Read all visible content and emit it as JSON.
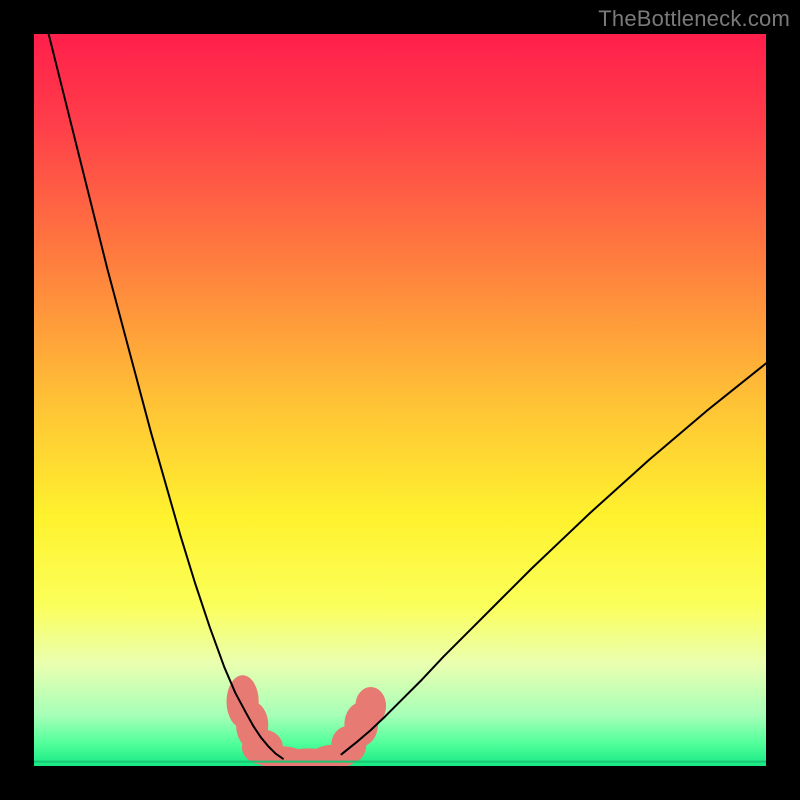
{
  "watermark": "TheBottleneck.com",
  "chart_data": {
    "type": "line",
    "title": "",
    "xlabel": "",
    "ylabel": "",
    "xlim": [
      0,
      100
    ],
    "ylim": [
      0,
      100
    ],
    "background_gradient": {
      "stops": [
        {
          "offset": 0.0,
          "color": "#ff1f4b"
        },
        {
          "offset": 0.12,
          "color": "#ff3d4a"
        },
        {
          "offset": 0.3,
          "color": "#ff7a3f"
        },
        {
          "offset": 0.5,
          "color": "#ffc136"
        },
        {
          "offset": 0.66,
          "color": "#fff22e"
        },
        {
          "offset": 0.78,
          "color": "#fbff5a"
        },
        {
          "offset": 0.86,
          "color": "#eaffb0"
        },
        {
          "offset": 0.93,
          "color": "#a7ffb8"
        },
        {
          "offset": 0.97,
          "color": "#4fff9a"
        },
        {
          "offset": 1.0,
          "color": "#17e884"
        }
      ]
    },
    "series": [
      {
        "name": "left-curve",
        "color": "#000000",
        "width": 2.0,
        "x": [
          0,
          2,
          4,
          6,
          8,
          10,
          12,
          14,
          16,
          18,
          20,
          22,
          24,
          26,
          27.5,
          29,
          30,
          31,
          32,
          33,
          34
        ],
        "y": [
          108,
          100,
          92,
          84,
          76,
          68,
          60.5,
          53,
          45.5,
          38.5,
          31.5,
          25,
          19,
          13.5,
          10,
          7.2,
          5.4,
          3.9,
          2.7,
          1.7,
          1.0
        ]
      },
      {
        "name": "right-curve",
        "color": "#000000",
        "width": 2.0,
        "x": [
          42,
          43,
          44,
          46,
          48,
          50,
          53,
          56,
          60,
          64,
          68,
          72,
          76,
          80,
          84,
          88,
          92,
          96,
          100
        ],
        "y": [
          1.6,
          2.4,
          3.2,
          4.9,
          6.8,
          8.8,
          11.8,
          15.0,
          19.0,
          23.0,
          27.0,
          30.8,
          34.6,
          38.2,
          41.8,
          45.2,
          48.6,
          51.8,
          55.0
        ]
      },
      {
        "name": "floor-line",
        "color": "#17c774",
        "width": 2.0,
        "x": [
          0,
          100
        ],
        "y": [
          0.6,
          0.6
        ]
      }
    ],
    "highlight_blobs": {
      "color": "#e77a73",
      "points": [
        {
          "x": 28.5,
          "y": 8.8,
          "rx": 2.2,
          "ry": 3.6,
          "rot": 0
        },
        {
          "x": 29.8,
          "y": 5.6,
          "rx": 2.2,
          "ry": 3.2,
          "rot": 0
        },
        {
          "x": 31.2,
          "y": 2.6,
          "rx": 2.8,
          "ry": 2.4,
          "rot": 0
        },
        {
          "x": 33.8,
          "y": 1.1,
          "rx": 3.4,
          "ry": 1.6,
          "rot": 0
        },
        {
          "x": 37.5,
          "y": 0.9,
          "rx": 4.2,
          "ry": 1.5,
          "rot": 0
        },
        {
          "x": 41.0,
          "y": 1.3,
          "rx": 3.2,
          "ry": 1.6,
          "rot": 0
        },
        {
          "x": 43.0,
          "y": 2.9,
          "rx": 2.4,
          "ry": 2.6,
          "rot": 0
        },
        {
          "x": 44.7,
          "y": 5.7,
          "rx": 2.3,
          "ry": 3.0,
          "rot": 0
        },
        {
          "x": 46.0,
          "y": 8.2,
          "rx": 2.1,
          "ry": 2.6,
          "rot": 0
        }
      ]
    }
  }
}
